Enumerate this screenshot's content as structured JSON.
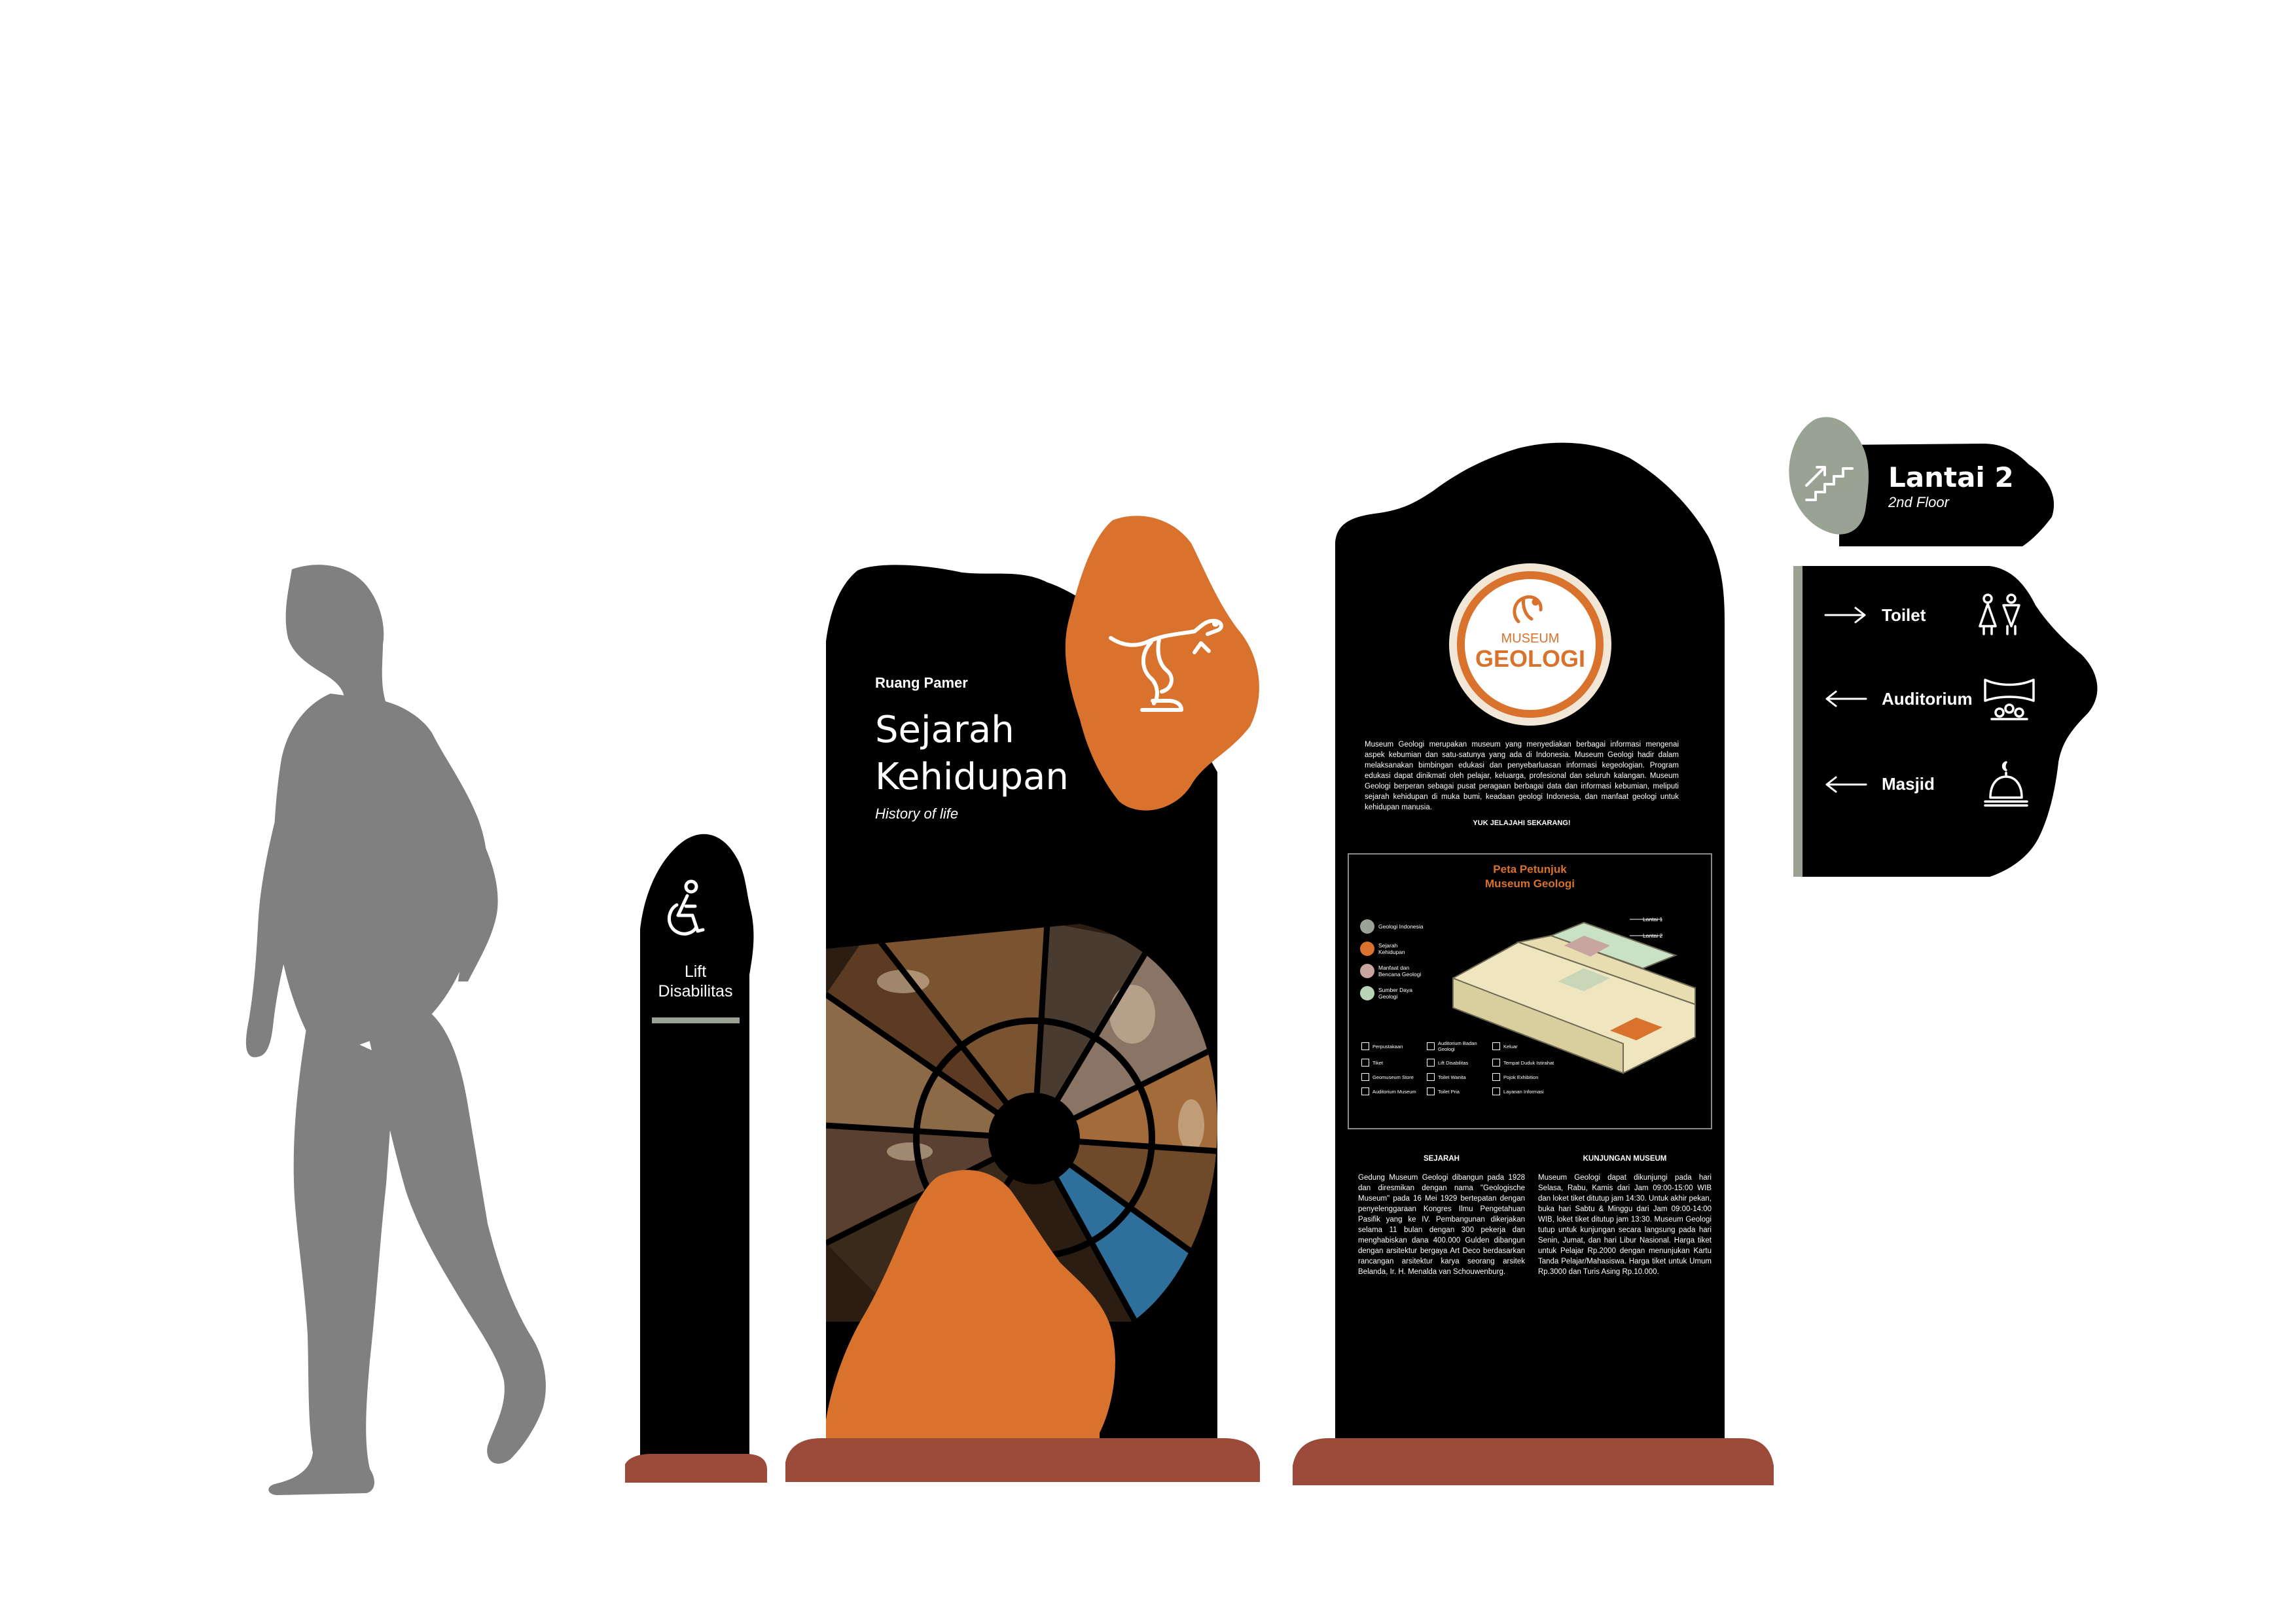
{
  "colors": {
    "sign_black": "#000000",
    "accent_orange": "#D9722C",
    "base_brown": "#9C4A3A",
    "sage": "#9AA393",
    "figure_gray": "#808080",
    "cream_ring": "#F2E6D6"
  },
  "lift_sign": {
    "icon": "wheelchair-icon",
    "label_line1": "Lift",
    "label_line2": "Disabilitas"
  },
  "gallery_sign": {
    "eyebrow": "Ruang Pamer",
    "title_line1": "Sejarah",
    "title_line2": "Kehidupan",
    "subtitle": "History of life",
    "badge_icon": "dinosaur-skeleton-icon"
  },
  "info_board": {
    "logo_line1": "MUSEUM",
    "logo_line2": "GEOLOGI",
    "intro": "Museum Geologi merupakan museum yang menyediakan berbagai informasi mengenai aspek kebumian dan satu-satunya yang ada di Indonesia. Museum Geologi hadir dalam melaksanakan bimbingan edukasi dan penyebarluasan informasi kegeologian. Program edukasi dapat dinikmati oleh pelajar, keluarga, profesional dan seluruh kalangan. Museum Geologi berperan sebagai pusat peragaan berbagai data dan informasi kebumian, meliputi sejarah kehidupan di muka bumi, keadaan geologi Indonesia, dan manfaat geologi untuk kehidupan manusia.",
    "cta": "YUK JELAJAHI SEKARANG!",
    "map_title_line1": "Peta Petunjuk",
    "map_title_line2": "Museum Geologi",
    "floor_labels": [
      "Lantai 1",
      "Lantai 2"
    ],
    "legend": [
      {
        "label": "Geologi Indonesia",
        "color": "#9AA393"
      },
      {
        "label": "Sejarah Kehidupan",
        "color": "#D9722C"
      },
      {
        "label": "Manfaat dan Bencana Geologi",
        "color": "#C9A5A0"
      },
      {
        "label": "Sumber Daya Geologi",
        "color": "#B9D3B6"
      }
    ],
    "facilities": [
      "Perpustakaan",
      "Auditorium Badan Geologi",
      "Keluar",
      "Tiket",
      "Lift Disabilitas",
      "Tempat Duduk Istirahat",
      "Geomuseum Store",
      "Toilet Wanita",
      "Pojok Exhibition",
      "Auditorium Museum",
      "Toilet Pria",
      "Layanan Informasi"
    ],
    "sejarah_title": "SEJARAH",
    "sejarah_text": "Gedung Museum Geologi dibangun pada 1928 dan diresmikan dengan nama \"Geologische Museum\" pada 16 Mei 1929 bertepatan dengan penyelenggaraan Kongres Ilmu Pengetahuan Pasifik yang ke IV. Pembangunan dikerjakan selama 11 bulan dengan 300 pekerja dan menghabiskan dana 400.000 Gulden dibangun dengan arsitektur bergaya Art Deco berdasarkan rancangan arsitektur karya seorang arsitek Belanda, Ir. H. Menalda van Schouwenburg.",
    "kunjungan_title": "KUNJUNGAN MUSEUM",
    "kunjungan_text": "Museum Geologi dapat dikunjungi pada hari Selasa, Rabu, Kamis dari Jam 09:00-15:00 WIB dan loket tiket ditutup jam 14:30. Untuk akhir pekan, buka hari Sabtu & Minggu dari Jam 09:00-14:00 WIB, loket tiket ditutup jam 13:30. Museum Geologi tutup untuk kunjungan secara langsung pada hari Senin, Jumat, dan hari Libur Nasional. Harga tiket untuk Pelajar Rp.2000 dengan menunjukan Kartu Tanda Pelajar/Mahasiswa. Harga tiket untuk Umum Rp.3000 dan Turis Asing Rp.10.000."
  },
  "floor_sign": {
    "icon": "stairs-up-icon",
    "title": "Lantai 2",
    "subtitle": "2nd Floor"
  },
  "directional_sign": {
    "items": [
      {
        "arrow": "arrow-right-icon",
        "label": "Toilet",
        "icon": "toilet-icon"
      },
      {
        "arrow": "arrow-left-icon",
        "label": "Auditorium",
        "icon": "auditorium-icon"
      },
      {
        "arrow": "arrow-left-icon",
        "label": "Masjid",
        "icon": "mosque-icon"
      }
    ]
  }
}
